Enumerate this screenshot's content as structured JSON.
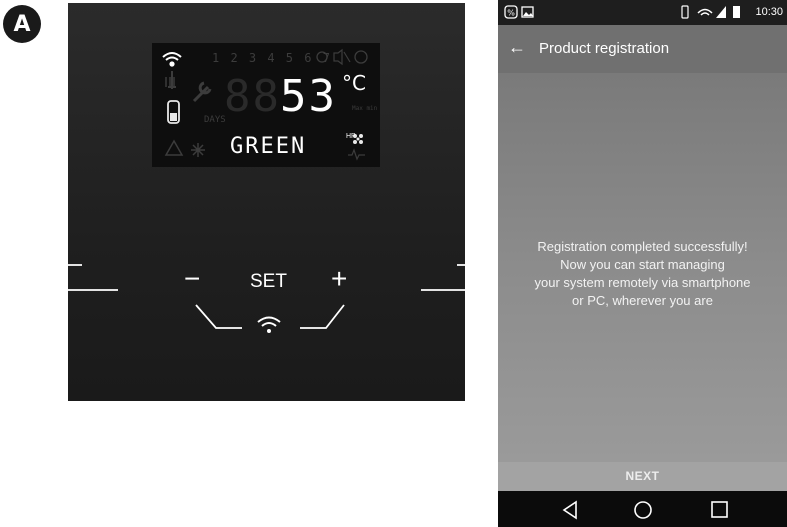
{
  "figure_label": "A",
  "thermostat": {
    "lcd": {
      "program_numbers": "1 2 3 4 5 6 7",
      "temperature": "53",
      "unit": "°C",
      "mode": "GREEN",
      "days_label": "DAYS",
      "minmax_label": "Max\nmin",
      "hp_label": "HP"
    },
    "buttons": {
      "minus": "−",
      "set": "SET",
      "plus": "+"
    }
  },
  "phone": {
    "status_bar": {
      "time": "10:30"
    },
    "app_bar": {
      "title": "Product registration"
    },
    "message_lines": [
      "Registration completed successfully!",
      "Now you can start managing",
      "your system remotely via smartphone",
      "or PC, wherever you are"
    ],
    "next_button": "NEXT",
    "accent_color": "#707070"
  }
}
